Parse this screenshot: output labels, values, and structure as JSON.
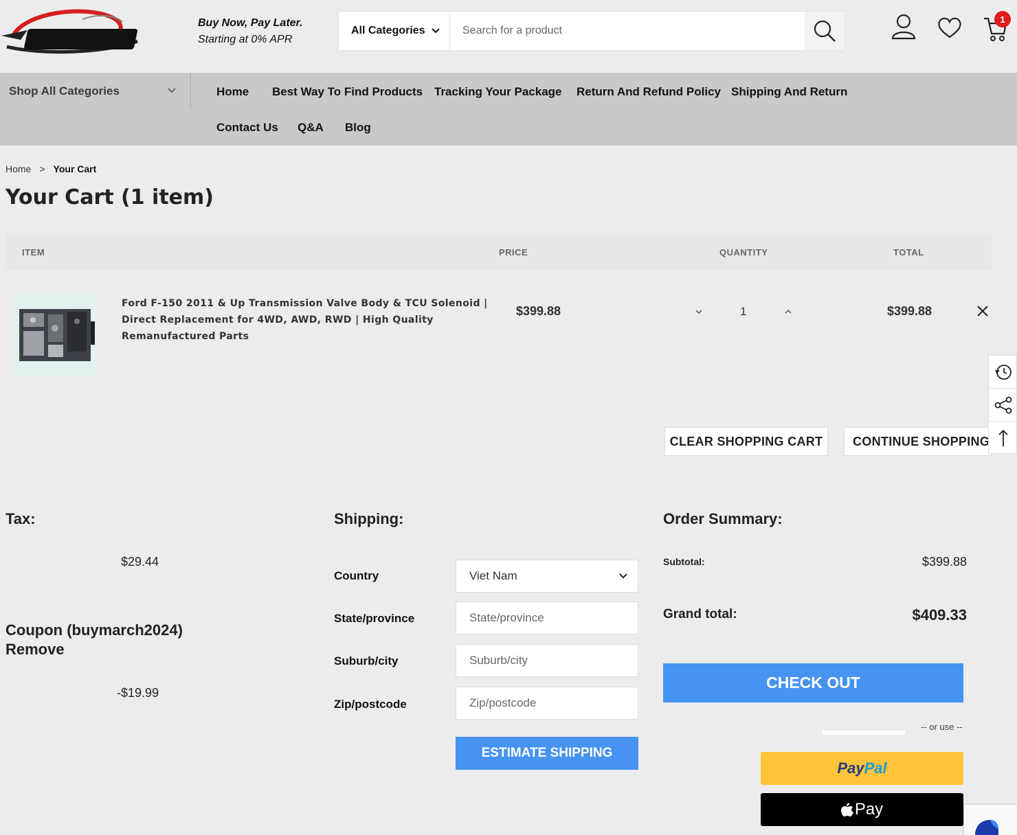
{
  "header": {
    "promo_line1": "Buy Now, Pay Later.",
    "promo_line2": "Starting at 0% APR",
    "category_select": "All Categories",
    "search_placeholder": "Search for a product",
    "cart_count": "1"
  },
  "nav": {
    "shop_all": "Shop All Categories",
    "items": [
      "Home",
      "Best Way To Find Products",
      "Tracking Your Package",
      "Return And Refund Policy",
      "Shipping And Return",
      "Contact Us",
      "Q&A",
      "Blog"
    ]
  },
  "breadcrumb": {
    "home": "Home",
    "separator": ">",
    "current": "Your Cart"
  },
  "page_title": "Your Cart (1 item)",
  "cart": {
    "headers": {
      "item": "ITEM",
      "price": "PRICE",
      "quantity": "QUANTITY",
      "total": "TOTAL"
    },
    "items": [
      {
        "title": "Ford F-150 2011 & Up Transmission Valve Body & TCU Solenoid | Direct Replacement for 4WD, AWD, RWD | High Quality Remanufactured Parts",
        "price": "$399.88",
        "quantity": "1",
        "total": "$399.88"
      }
    ],
    "clear_button": "CLEAR SHOPPING CART",
    "continue_button": "CONTINUE SHOPPING"
  },
  "tax": {
    "heading": "Tax:",
    "value": "$29.44"
  },
  "coupon": {
    "heading": "Coupon (buymarch2024)",
    "remove": "Remove",
    "value": "-$19.99"
  },
  "shipping": {
    "heading": "Shipping:",
    "country_label": "Country",
    "country_value": "Viet Nam",
    "state_label": "State/province",
    "state_placeholder": "State/province",
    "city_label": "Suburb/city",
    "city_placeholder": "Suburb/city",
    "zip_label": "Zip/postcode",
    "zip_placeholder": "Zip/postcode",
    "estimate_button": "ESTIMATE SHIPPING"
  },
  "summary": {
    "heading": "Order Summary:",
    "subtotal_label": "Subtotal:",
    "subtotal_value": "$399.88",
    "grand_total_label": "Grand total:",
    "grand_total_value": "$409.33",
    "checkout_button": "CHECK OUT",
    "or_use": "-- or use --",
    "paypal_part1": "Pay",
    "paypal_part2": "Pal",
    "applepay_label": "Pay"
  },
  "colors": {
    "accent_blue": "#4693f1",
    "nav_bg": "#c9c9c9",
    "page_bg": "#ececec",
    "paypal_yellow": "#ffc439",
    "badge_red": "#e21b1b"
  },
  "icons": [
    "logo-icon",
    "chevron-down-icon",
    "search-icon",
    "user-icon",
    "heart-icon",
    "cart-icon",
    "close-icon",
    "chevron-up-icon",
    "history-icon",
    "share-icon",
    "arrow-up-icon",
    "apple-icon"
  ]
}
